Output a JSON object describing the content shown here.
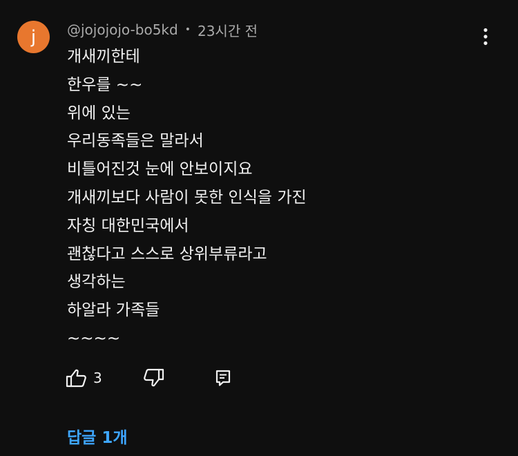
{
  "comment": {
    "avatar_letter": "j",
    "avatar_color": "#e8772e",
    "author": "@jojojojo-bo5kd",
    "separator": "•",
    "timestamp": "23시간 전",
    "lines": [
      "개새끼한테",
      "한우를 ~~",
      "위에 있는",
      "우리동족들은 말라서",
      "비틀어진것 눈에 안보이지요",
      "개새끼보다 사람이 못한 인식을 가진",
      "자칭 대한민국에서",
      "괜찮다고 스스로 상위부류라고",
      "생각하는",
      "하알라 가족들",
      "~~~~"
    ],
    "like_count": "3",
    "replies_label": "답글 1개",
    "accent_color": "#3ea6ff",
    "icons": {
      "more": "more-vert-icon",
      "like": "thumbs-up-icon",
      "dislike": "thumbs-down-icon",
      "reply": "comment-reply-icon"
    }
  }
}
